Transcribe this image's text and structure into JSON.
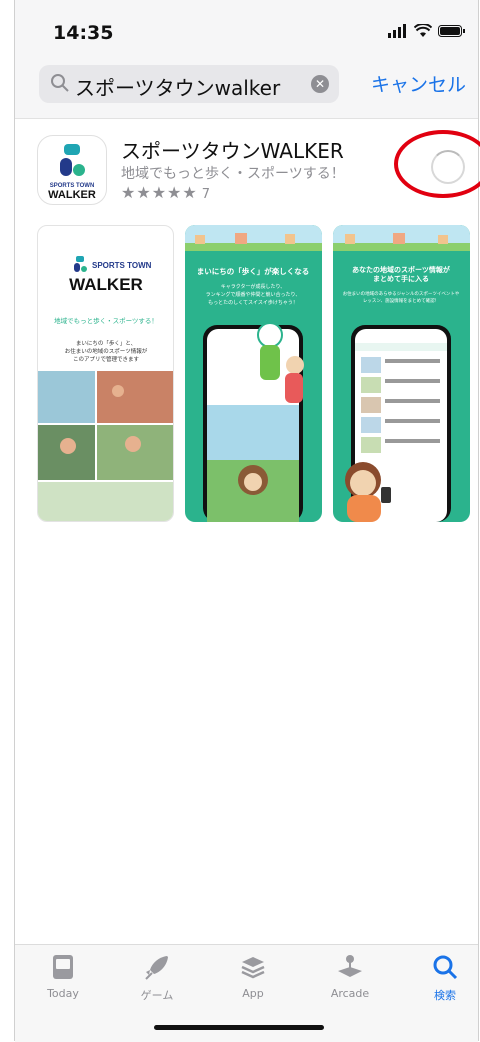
{
  "status": {
    "time": "14:35"
  },
  "search": {
    "query": "スポーツタウンwalker",
    "cancel_label": "キャンセル"
  },
  "app": {
    "title": "スポーツタウンWALKER",
    "subtitle": "地域でもっと歩く・スポーツする！",
    "stars": "★★★★★",
    "rating_count": "7",
    "icon_text_top": "SPORTS TOWN",
    "icon_text_bottom": "WALKER"
  },
  "screenshots": [
    {
      "logo_small": "SPORTS TOWN",
      "logo_big": "WALKER",
      "tagline": "地域でもっと歩く・スポーツする！",
      "desc1": "まいにちの「歩く」と、",
      "desc2": "お住まいの地域のスポーツ情報が",
      "desc3": "このアプリで管理できます"
    },
    {
      "headline": "まいにちの「歩く」が楽しくなる",
      "body1": "キャラクターが成長したり、",
      "body2": "ランキングで順番や仲間と競い合ったり、",
      "body3": "もっとたのしくてスイスイ歩けちゃう！"
    },
    {
      "headline1": "あなたの地域のスポーツ情報が",
      "headline2": "まとめて手に入る",
      "body1": "お住まいの地域のあらゆるジャンルのスポーツイベントや",
      "body2": "レッスン、施設情報をまとめて確認！"
    }
  ],
  "tabs": [
    {
      "label": "Today",
      "icon": "today-icon"
    },
    {
      "label": "ゲーム",
      "icon": "rocket-icon"
    },
    {
      "label": "App",
      "icon": "layers-icon"
    },
    {
      "label": "Arcade",
      "icon": "arcade-icon"
    },
    {
      "label": "検索",
      "icon": "search-icon"
    }
  ],
  "colors": {
    "accent": "#1a73e8",
    "highlight_circle": "#e10010",
    "screenshot_green": "#2bb38d"
  }
}
